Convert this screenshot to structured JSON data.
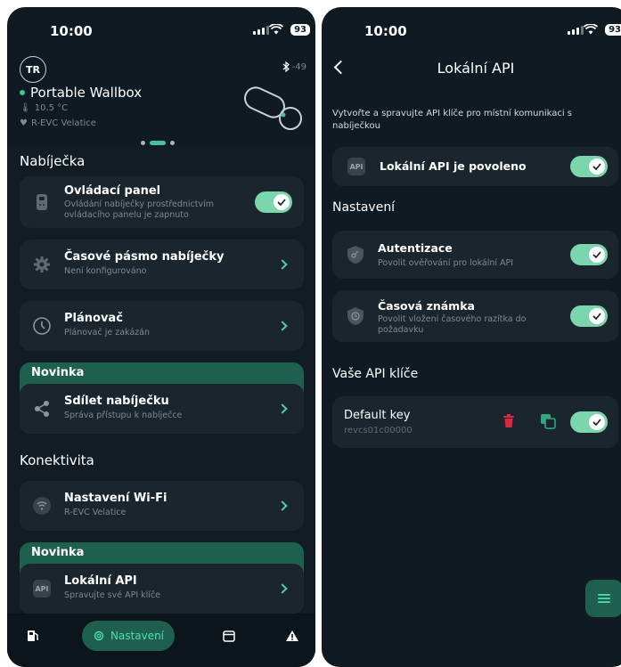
{
  "status": {
    "time": "10:00",
    "battery": "93"
  },
  "left": {
    "avatar": "TR",
    "bluetooth_rssi": "-49",
    "device_name": "Portable Wallbox",
    "temperature": "10.5 °C",
    "location": "R-EVC Velatice",
    "section_charger": "Nabíječka",
    "control_panel": {
      "title": "Ovládací panel",
      "sub": "Ovládání nabíječky prostřednictvím ovládacího panelu je zapnuto",
      "enabled": true
    },
    "timezone": {
      "title": "Časové pásmo nabíječky",
      "sub": "Není konfigurováno"
    },
    "scheduler": {
      "title": "Plánovač",
      "sub": "Plánovač je zakázán"
    },
    "promo1_label": "Novinka",
    "share": {
      "title": "Sdílet nabíječku",
      "sub": "Správa přístupu k nabíječce"
    },
    "section_connectivity": "Konektivita",
    "wifi": {
      "title": "Nastavení Wi-Fi",
      "sub": "R-EVC Velatice"
    },
    "promo2_label": "Novinka",
    "local_api": {
      "title": "Lokální API",
      "sub": "Spravujte své API klíče"
    },
    "api_badge": "API",
    "nav": {
      "active_label": "Nastavení"
    }
  },
  "right": {
    "title": "Lokální API",
    "description": "Vytvořte a spravujte API klíče pro místní komunikaci s nabíječkou",
    "api_badge": "API",
    "enabled_label": "Lokální API je povoleno",
    "section_settings": "Nastavení",
    "auth": {
      "title": "Autentizace",
      "sub": "Povolit ověřování pro lokální API"
    },
    "timestamp": {
      "title": "Časová známka",
      "sub": "Povolit vložení časového razítka do požadavku"
    },
    "section_keys": "Vaše API klíče",
    "key": {
      "name": "Default key",
      "id": "revcs01c00000"
    }
  },
  "colors": {
    "accent": "#4fd1a8",
    "toggle_on": "#7bd6ae",
    "promo": "#1f5f4e",
    "delete": "#e0263c"
  }
}
